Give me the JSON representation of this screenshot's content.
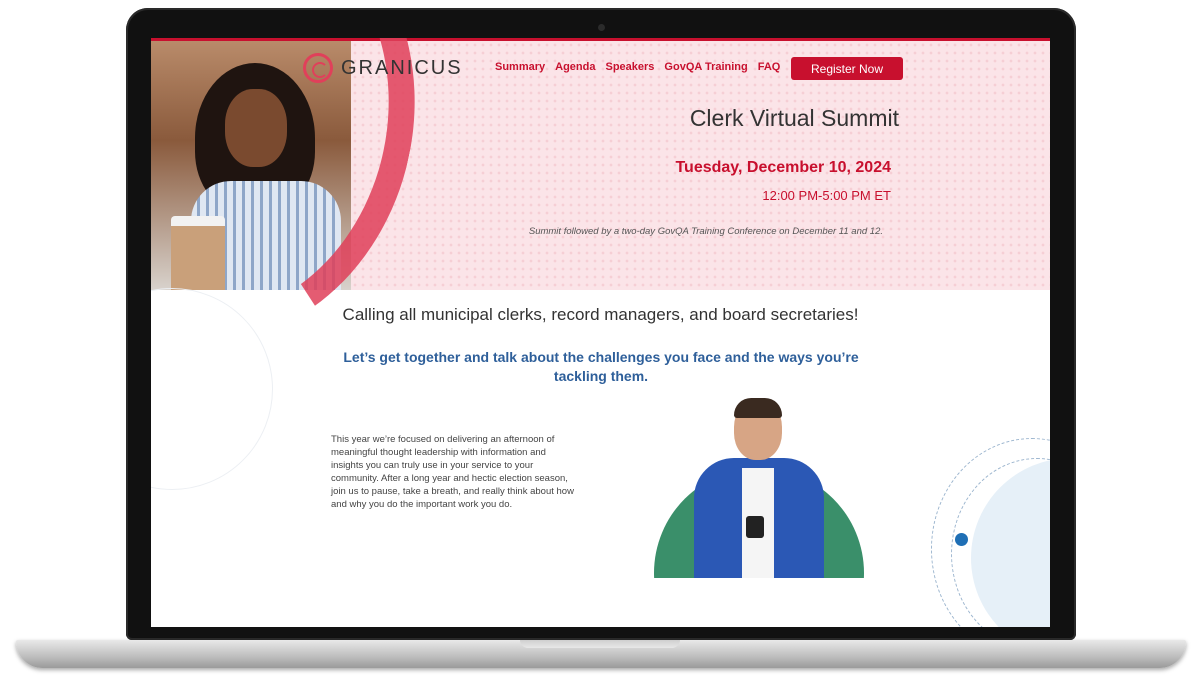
{
  "brand": {
    "name": "GRANICUS"
  },
  "nav": {
    "items": [
      "Summary",
      "Agenda",
      "Speakers",
      "GovQA Training",
      "FAQ"
    ],
    "cta": "Register Now"
  },
  "hero": {
    "title": "Clerk Virtual Summit",
    "date": "Tuesday, December 10, 2024",
    "time": "12:00 PM-5:00 PM ET",
    "followup": "Summit followed by a two-day GovQA Training Conference on December 11 and 12."
  },
  "main": {
    "callout": "Calling all municipal clerks, record managers, and board secretaries!",
    "tagline": "Let’s get together and talk about the challenges you face and the ways you’re tackling them.",
    "paragraph": "This year we’re focused on delivering an afternoon of meaningful thought leadership with information and insights you can truly use in your service to your community. After a long year and hectic election season, join us to pause, take a breath, and really think about how and why you do the important work you do."
  },
  "colors": {
    "accent": "#c8102e",
    "tagline": "#2e5f9a",
    "hero_bg": "#fbe4e8",
    "semicircle": "#3a8f6a"
  }
}
